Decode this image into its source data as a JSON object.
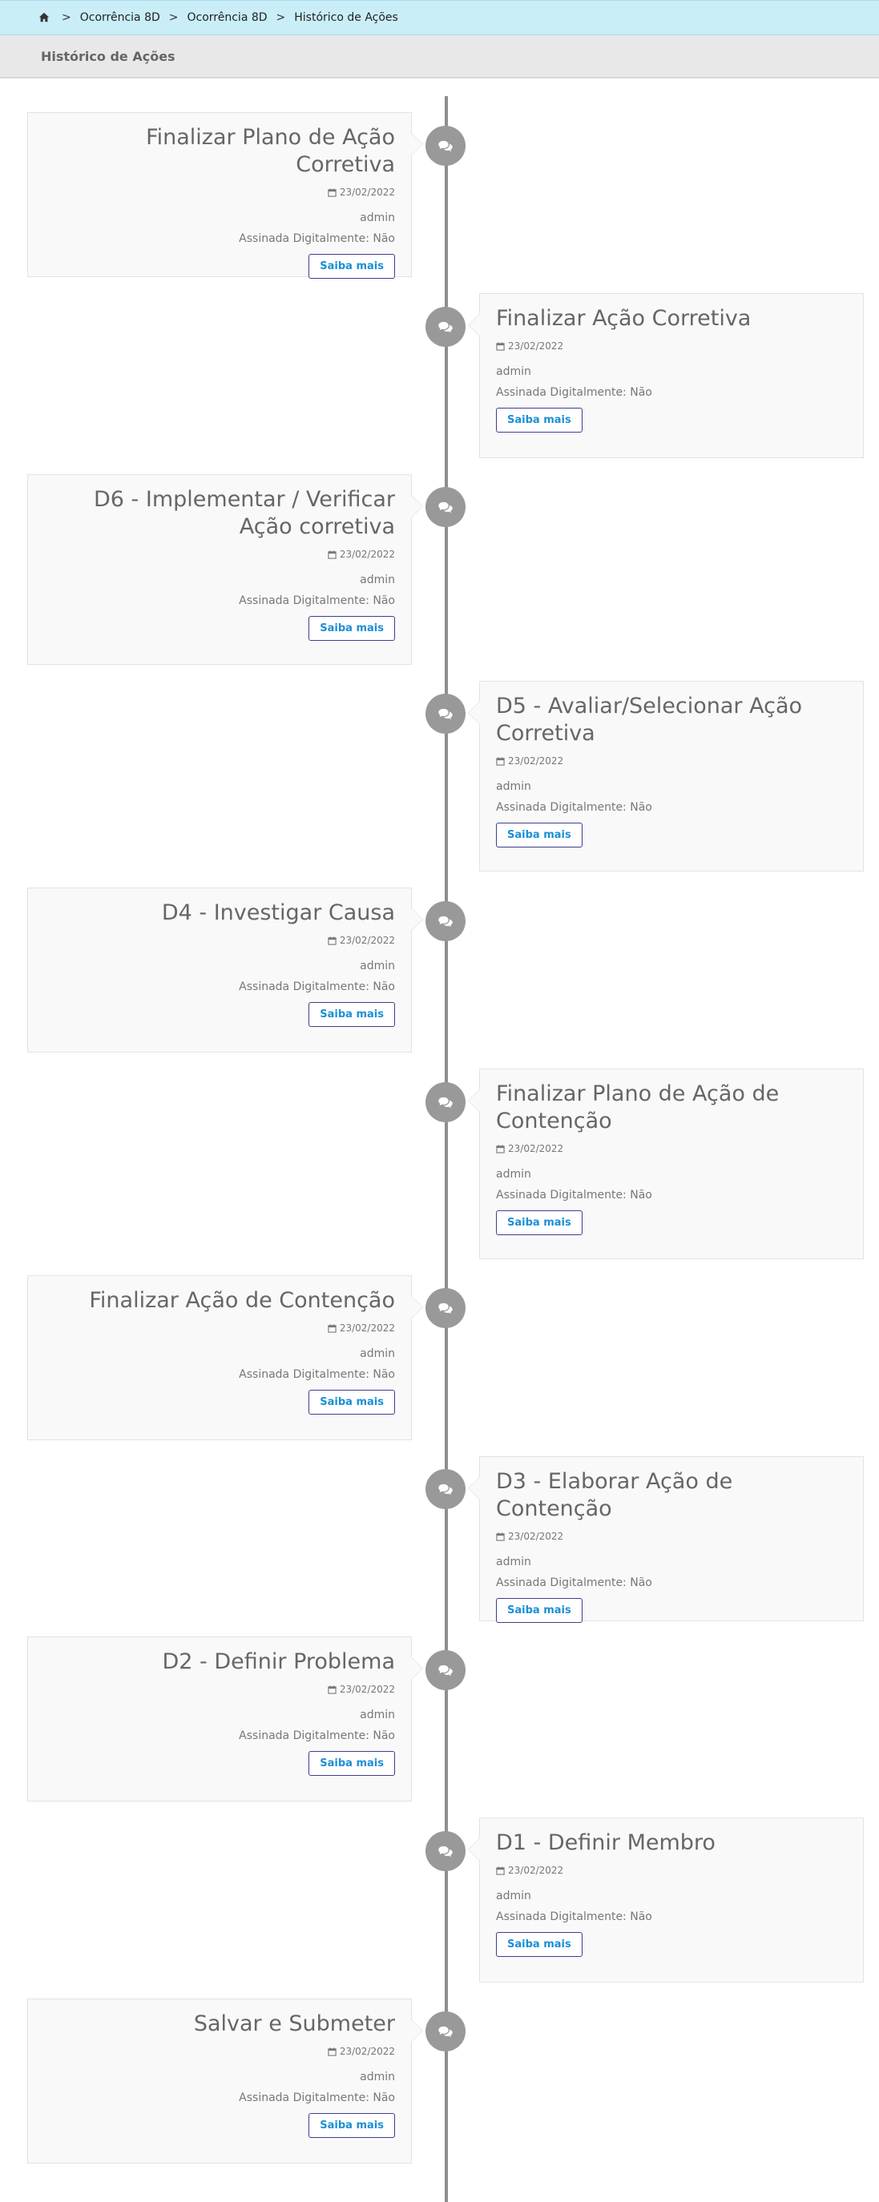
{
  "breadcrumb": {
    "home_icon": "home-icon",
    "separator": ">",
    "items": [
      "Ocorrência 8D",
      "Ocorrência 8D",
      "Histórico de Ações"
    ]
  },
  "page_title": "Histórico de Ações",
  "badge_icon": "comments-icon",
  "date_icon": "calendar-icon",
  "timeline": [
    {
      "title": "Finalizar Plano de Ação Corretiva",
      "date": "23/02/2022",
      "user": "admin",
      "signed": "Assinada Digitalmente: Não",
      "button": "Saiba mais",
      "side": "left"
    },
    {
      "title": "Finalizar Ação Corretiva",
      "date": "23/02/2022",
      "user": "admin",
      "signed": "Assinada Digitalmente: Não",
      "button": "Saiba mais",
      "side": "right"
    },
    {
      "title": "D6 - Implementar / Verificar Ação corretiva",
      "date": "23/02/2022",
      "user": "admin",
      "signed": "Assinada Digitalmente: Não",
      "button": "Saiba mais",
      "side": "left"
    },
    {
      "title": "D5 - Avaliar/Selecionar Ação Corretiva",
      "date": "23/02/2022",
      "user": "admin",
      "signed": "Assinada Digitalmente: Não",
      "button": "Saiba mais",
      "side": "right"
    },
    {
      "title": "D4 - Investigar Causa",
      "date": "23/02/2022",
      "user": "admin",
      "signed": "Assinada Digitalmente: Não",
      "button": "Saiba mais",
      "side": "left"
    },
    {
      "title": "Finalizar Plano de Ação de Contenção",
      "date": "23/02/2022",
      "user": "admin",
      "signed": "Assinada Digitalmente: Não",
      "button": "Saiba mais",
      "side": "right"
    },
    {
      "title": "Finalizar Ação de Contenção",
      "date": "23/02/2022",
      "user": "admin",
      "signed": "Assinada Digitalmente: Não",
      "button": "Saiba mais",
      "side": "left"
    },
    {
      "title": "D3 - Elaborar Ação de Contenção",
      "date": "23/02/2022",
      "user": "admin",
      "signed": "Assinada Digitalmente: Não",
      "button": "Saiba mais",
      "side": "right"
    },
    {
      "title": "D2 - Definir Problema",
      "date": "23/02/2022",
      "user": "admin",
      "signed": "Assinada Digitalmente: Não",
      "button": "Saiba mais",
      "side": "left"
    },
    {
      "title": "D1 - Definir Membro",
      "date": "23/02/2022",
      "user": "admin",
      "signed": "Assinada Digitalmente: Não",
      "button": "Saiba mais",
      "side": "right"
    },
    {
      "title": "Salvar e Submeter",
      "date": "23/02/2022",
      "user": "admin",
      "signed": "Assinada Digitalmente: Não",
      "button": "Saiba mais",
      "side": "left"
    }
  ]
}
